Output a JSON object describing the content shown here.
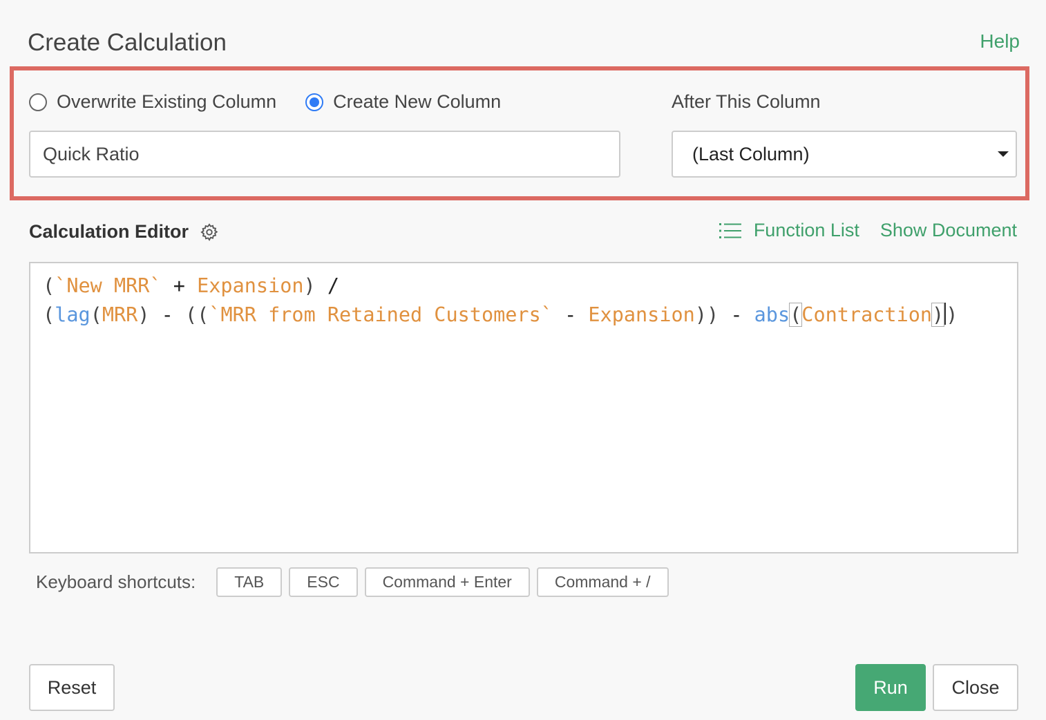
{
  "dialog": {
    "title": "Create Calculation",
    "help_label": "Help"
  },
  "column_mode": {
    "options": [
      {
        "label": "Overwrite Existing Column",
        "checked": false
      },
      {
        "label": "Create New Column",
        "checked": true
      }
    ],
    "new_column_name": "Quick Ratio",
    "after_label": "After This Column",
    "after_selected": "(Last Column)"
  },
  "editor": {
    "label": "Calculation Editor",
    "function_list_label": "Function List",
    "show_document_label": "Show Document",
    "code_lines": [
      [
        {
          "t": "(",
          "k": "p"
        },
        {
          "t": "`New MRR`",
          "k": "c"
        },
        {
          "t": " + ",
          "k": "o"
        },
        {
          "t": "Expansion",
          "k": "c"
        },
        {
          "t": ") ",
          "k": "p"
        },
        {
          "t": "/",
          "k": "o"
        }
      ],
      [
        {
          "t": "(",
          "k": "p"
        },
        {
          "t": "lag",
          "k": "f"
        },
        {
          "t": "(",
          "k": "p"
        },
        {
          "t": "MRR",
          "k": "c"
        },
        {
          "t": ") ",
          "k": "p"
        },
        {
          "t": "- ",
          "k": "o"
        },
        {
          "t": "((",
          "k": "p"
        },
        {
          "t": "`MRR from Retained Customers`",
          "k": "c"
        },
        {
          "t": " - ",
          "k": "o"
        },
        {
          "t": "Expansion",
          "k": "c"
        },
        {
          "t": ")) ",
          "k": "p"
        },
        {
          "t": "- ",
          "k": "o"
        },
        {
          "t": "abs",
          "k": "f"
        },
        {
          "t": "(",
          "k": "p",
          "m": true
        },
        {
          "t": "Contraction",
          "k": "c"
        },
        {
          "t": ")",
          "k": "p",
          "m": true
        },
        {
          "cursor": true
        },
        {
          "t": ")",
          "k": "p"
        }
      ]
    ]
  },
  "shortcuts": {
    "label": "Keyboard shortcuts:",
    "keys": [
      "TAB",
      "ESC",
      "Command + Enter",
      "Command + /"
    ]
  },
  "footer": {
    "reset_label": "Reset",
    "run_label": "Run",
    "close_label": "Close"
  },
  "colors": {
    "accent_green": "#3fa06b",
    "highlight_red": "#dc6a62",
    "radio_blue": "#2f7bf5",
    "token_column": "#e0913f",
    "token_function": "#5a96dd"
  }
}
